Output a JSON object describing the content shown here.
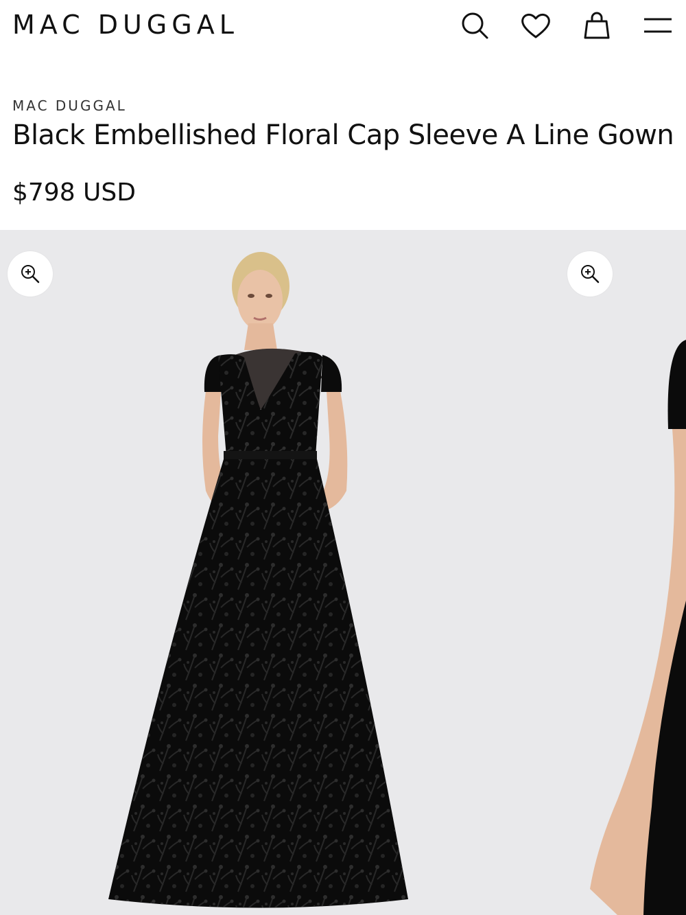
{
  "header": {
    "logo": "MAC DUGGAL",
    "icons": [
      "search-icon",
      "heart-icon",
      "shopping-bag-icon",
      "menu-icon"
    ]
  },
  "product": {
    "brand": "MAC DUGGAL",
    "title": "Black Embellished Floral Cap Sleeve A Line Gown",
    "price": "$798 USD"
  },
  "gallery": {
    "zoom_icon": "zoom-in-icon",
    "colors": {
      "background": "#e9e9eb",
      "gown": "#0b0b0b",
      "skin": "#e9c2a6",
      "hair": "#d9c08a"
    }
  }
}
